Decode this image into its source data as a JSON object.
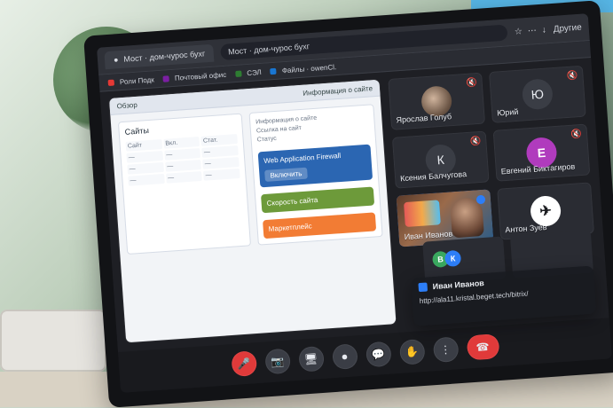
{
  "browser": {
    "tab_label": "Мост · дом-чурос бухг",
    "address_text": "Мост · дом-чурос бухг",
    "more_label": "Другие"
  },
  "bookmarks": [
    {
      "label": "Роли Подк",
      "color": "#e53935"
    },
    {
      "label": "Почтовый офис",
      "color": "#7b1fa2"
    },
    {
      "label": "СЭЛ",
      "color": "#2e7d32"
    },
    {
      "label": "Файлы · owenCl.",
      "color": "#1976d2"
    }
  ],
  "shared_screen": {
    "header_left": "Обзор",
    "header_right": "Информация о сайте",
    "table_headers": [
      "Сайт",
      "Вкл.",
      "Стат."
    ],
    "promo_blue_title": "Web Application Firewall",
    "promo_blue_button": "Включить",
    "promo_green_title": "Скорость сайта",
    "promo_orange_title": "Маркетплейс"
  },
  "participants": [
    {
      "name": "Ярослав Голуб",
      "avatar": "photo",
      "muted": true
    },
    {
      "name": "Юрий",
      "avatar": "letter",
      "letter": "Ю",
      "muted": true
    },
    {
      "name": "Ксения Балчугова",
      "avatar": "letter",
      "letter": "К",
      "muted": true
    },
    {
      "name": "Евгений Биктагиров",
      "avatar": "purple",
      "letter": "Е",
      "muted": true
    },
    {
      "name": "Иван Иванов",
      "avatar": "video",
      "active": true,
      "muted": false
    },
    {
      "name": "Антон Зуев",
      "avatar": "logo",
      "letter": "✈",
      "muted": false
    }
  ],
  "mini_tiles": [
    {
      "b1": "В",
      "b2": "К"
    },
    {
      "b1": "",
      "b2": ""
    }
  ],
  "chat_toast": {
    "author": "Иван Иванов",
    "message": "http://ala11.kristal.beget.tech/bitrix/"
  },
  "toolbar": {
    "buttons": [
      "mic",
      "camera",
      "screen",
      "record",
      "chat",
      "raise",
      "more",
      "end"
    ]
  }
}
